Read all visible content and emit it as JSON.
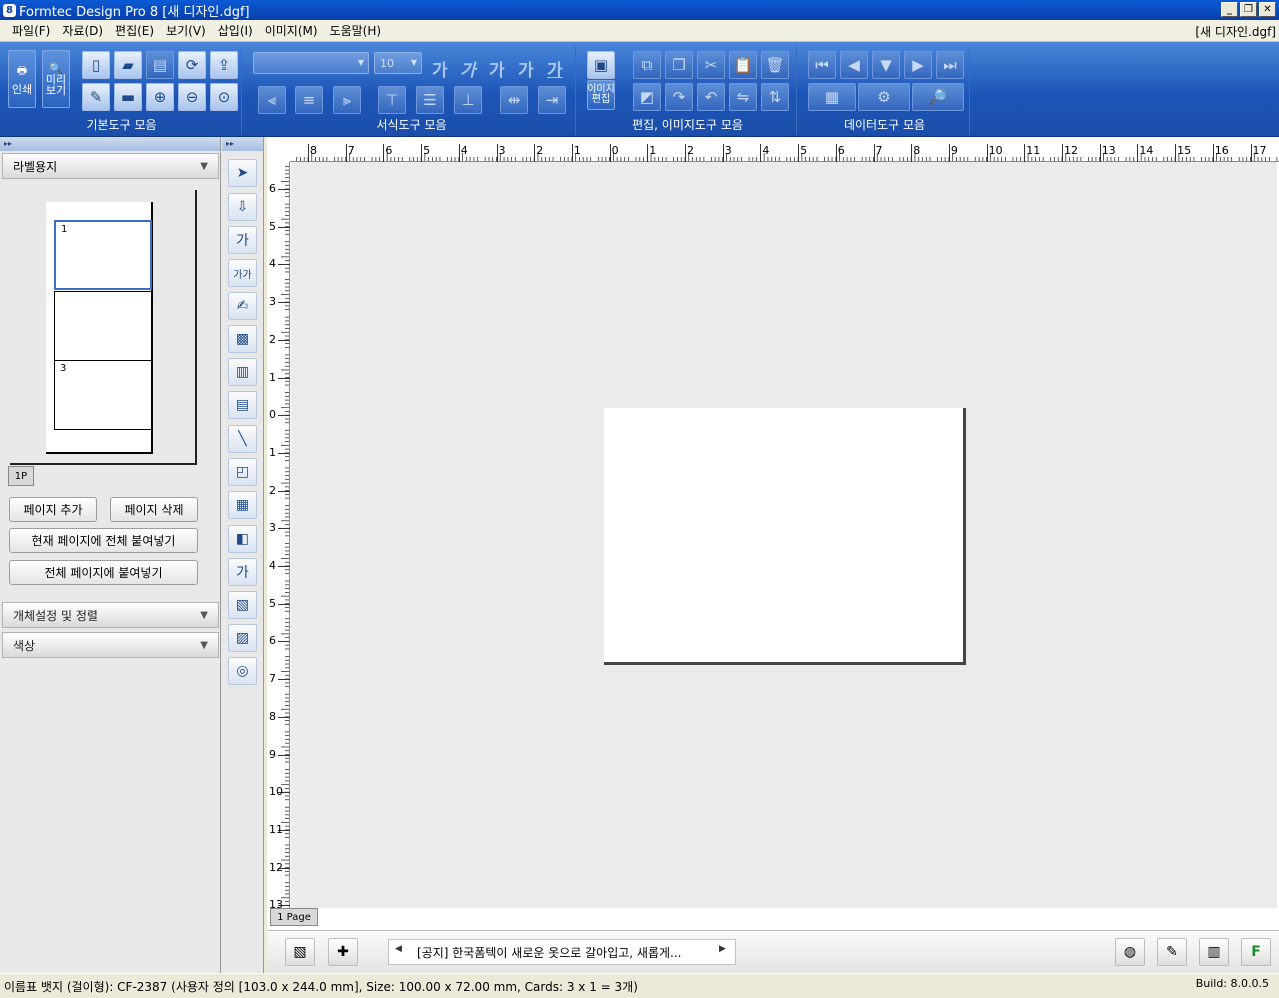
{
  "window": {
    "title": "Formtec Design Pro 8 [새 디자인.dgf]",
    "doc_name": "[새 디자인.dgf]",
    "minimize": "_",
    "restore": "❐",
    "close": "✕"
  },
  "menu": [
    "파일(F)",
    "자료(D)",
    "편집(E)",
    "보기(V)",
    "삽입(I)",
    "이미지(M)",
    "도움말(H)"
  ],
  "toolbar": {
    "groups": {
      "basic": "기본도구 모음",
      "format": "서식도구 모음",
      "edit_image": "편집, 이미지도구 모음",
      "data": "데이터도구 모음"
    },
    "print_label": "인쇄",
    "preview_label": "미리\n보기",
    "image_edit_label": "이미지\n편집",
    "font_name": "",
    "font_size": "10"
  },
  "left_panel": {
    "section_title": "라벨용지",
    "cell_numbers": [
      "1",
      "",
      "3"
    ],
    "page_tab": "1P",
    "add_page": "페이지 추가",
    "delete_page": "페이지 삭제",
    "paste_all_current": "현재 페이지에 전체 붙여넣기",
    "paste_all_pages": "전체 페이지에 붙여넣기",
    "object_settings": "개체설정 및 정렬",
    "color": "색상"
  },
  "ruler": {
    "h": [
      "8",
      "7",
      "6",
      "5",
      "4",
      "3",
      "2",
      "1",
      "0",
      "1",
      "2",
      "3",
      "4",
      "5",
      "6",
      "7",
      "8",
      "9",
      "10",
      "11",
      "12",
      "13",
      "14",
      "15",
      "16",
      "17"
    ],
    "v": [
      "6",
      "5",
      "4",
      "3",
      "2",
      "1",
      "0",
      "1",
      "2",
      "3",
      "4",
      "5",
      "6",
      "7",
      "8",
      "9",
      "10",
      "11",
      "12",
      "13"
    ]
  },
  "canvas": {
    "page_tab": "1 Page"
  },
  "bottom": {
    "notice": "[공지] 한국폼텍이 새로운 옷으로 갈아입고, 새롭게..."
  },
  "status": {
    "text": "이름표 뱃지 (걸이형): CF-2387 (사용자 정의 [103.0 x 244.0 mm], Size: 100.00 x 72.00 mm,  Cards: 3 x 1 = 3개)",
    "build": "Build: 8.0.0.5"
  }
}
